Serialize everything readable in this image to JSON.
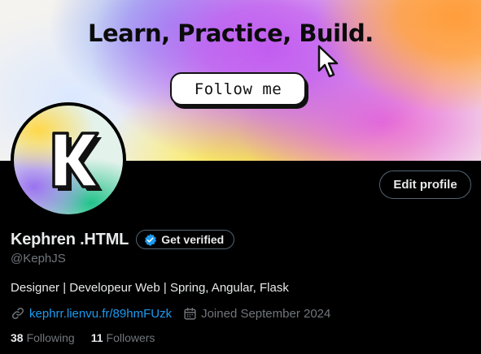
{
  "banner": {
    "headline": "Learn, Practice, Build.",
    "follow_button": "Follow me"
  },
  "avatar": {
    "letter": "K"
  },
  "actions": {
    "edit_profile": "Edit profile"
  },
  "profile": {
    "display_name": "Kephren .HTML",
    "verified_label": "Get verified",
    "handle": "@KephJS",
    "bio": "Designer | Developeur Web | Spring, Angular, Flask",
    "link": "kephrr.lienvu.fr/89hmFUzk",
    "joined": "Joined September 2024"
  },
  "stats": {
    "following_count": "38",
    "following_label": "Following",
    "followers_count": "11",
    "followers_label": "Followers"
  },
  "icons": {
    "verified": "verified-badge-icon",
    "link": "link-icon",
    "calendar": "calendar-icon",
    "cursor": "cursor-arrow-icon"
  },
  "colors": {
    "accent": "#1d9bf0",
    "background": "#000000",
    "muted": "#71767b",
    "text": "#e7e9ea"
  }
}
